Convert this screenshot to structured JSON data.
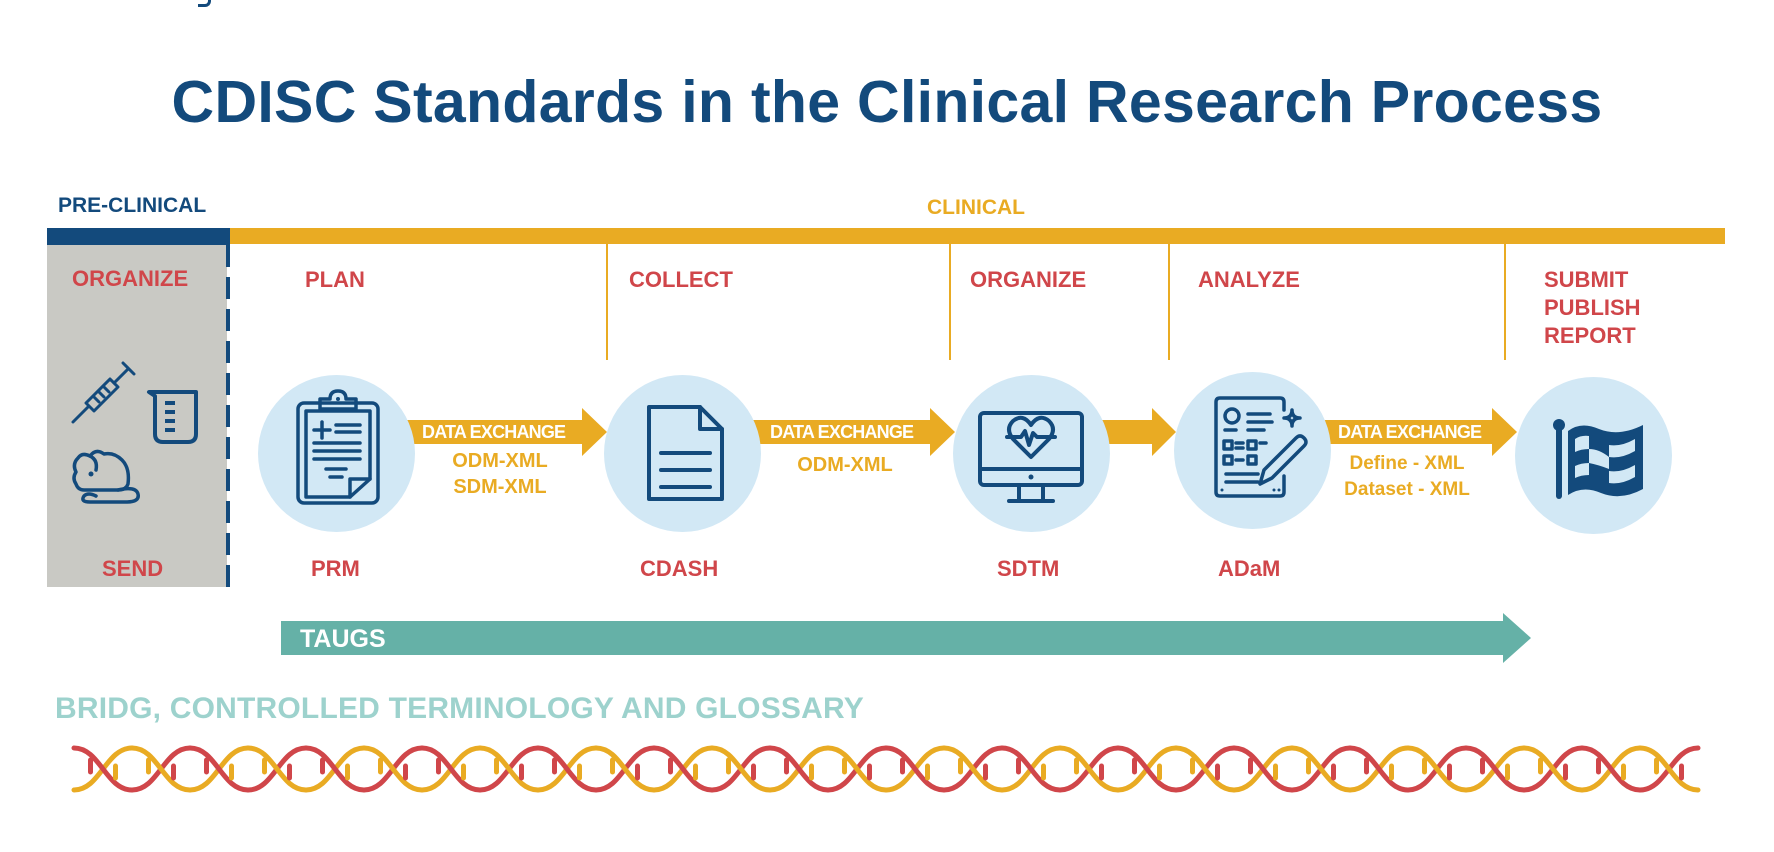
{
  "title": "CDISC Standards in the Clinical Research Process",
  "colors": {
    "navy": "#134a7c",
    "gold": "#e9ab23",
    "red": "#d0464a",
    "light_blue": "#d2e8f5",
    "gray_panel": "#c9c9c4",
    "teal": "#65b1a7",
    "light_teal": "#9dd2cd"
  },
  "phases": {
    "preclinical": {
      "label": "PRE-CLINICAL",
      "stage": "ORGANIZE",
      "standard": "SEND",
      "icons": [
        "syringe-icon",
        "beaker-icon",
        "mouse-icon"
      ]
    },
    "clinical": {
      "label": "CLINICAL"
    }
  },
  "stages": [
    {
      "label": "PLAN"
    },
    {
      "label": "COLLECT"
    },
    {
      "label": "ORGANIZE"
    },
    {
      "label": "ANALYZE"
    },
    {
      "label": "SUBMIT\nPUBLISH\nREPORT",
      "lines": [
        "SUBMIT",
        "PUBLISH",
        "REPORT"
      ]
    }
  ],
  "standards": [
    {
      "label": "PRM",
      "icon": "clipboard-icon"
    },
    {
      "label": "CDASH",
      "icon": "document-icon"
    },
    {
      "label": "SDTM",
      "icon": "monitor-heart-icon"
    },
    {
      "label": "ADaM",
      "icon": "report-pencil-icon"
    },
    {
      "label": "",
      "icon": "checkered-flag-icon"
    }
  ],
  "exchanges": [
    {
      "label": "DATA EXCHANGE",
      "formats": [
        "ODM-XML",
        "SDM-XML"
      ]
    },
    {
      "label": "DATA EXCHANGE",
      "formats": [
        "ODM-XML"
      ]
    },
    {
      "label": "",
      "formats": []
    },
    {
      "label": "DATA EXCHANGE",
      "formats": [
        "Define - XML",
        "Dataset - XML"
      ]
    }
  ],
  "taugs": {
    "label": "TAUGS"
  },
  "foundation": {
    "label": "BRIDG, CONTROLLED TERMINOLOGY AND GLOSSARY"
  }
}
